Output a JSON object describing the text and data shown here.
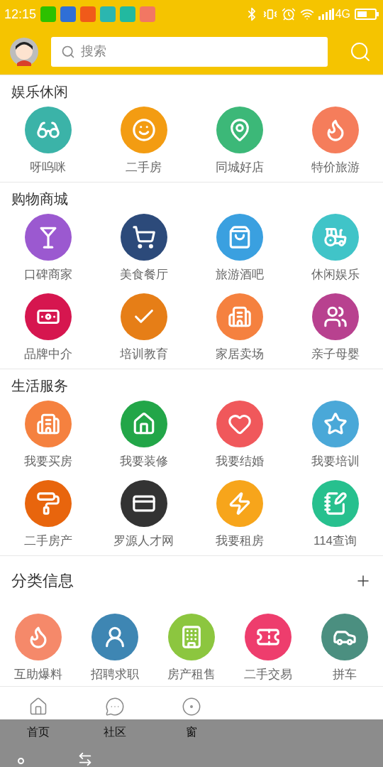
{
  "status_bar": {
    "time": "12:15",
    "network": "4G"
  },
  "search": {
    "placeholder": "搜索"
  },
  "sections": [
    {
      "title": "娱乐休闲",
      "items": [
        {
          "label": "呀呜咪",
          "color": "#3bb3a8"
        },
        {
          "label": "二手房",
          "color": "#f39c12"
        },
        {
          "label": "同城好店",
          "color": "#3cb878"
        },
        {
          "label": "特价旅游",
          "color": "#f57d5b"
        }
      ]
    },
    {
      "title": "购物商城",
      "items": [
        {
          "label": "口碑商家",
          "color": "#9b59d0"
        },
        {
          "label": "美食餐厅",
          "color": "#2c4a7a"
        },
        {
          "label": "旅游酒吧",
          "color": "#3aa0e0"
        },
        {
          "label": "休闲娱乐",
          "color": "#40c4c8"
        },
        {
          "label": "品牌中介",
          "color": "#d6164f"
        },
        {
          "label": "培训教育",
          "color": "#e67e17"
        },
        {
          "label": "家居卖场",
          "color": "#f5813f"
        },
        {
          "label": "亲子母婴",
          "color": "#b8418f"
        }
      ]
    },
    {
      "title": "生活服务",
      "items": [
        {
          "label": "我要买房",
          "color": "#f5813f"
        },
        {
          "label": "我要装修",
          "color": "#22a648"
        },
        {
          "label": "我要结婚",
          "color": "#f0585b"
        },
        {
          "label": "我要培训",
          "color": "#4aa8d8"
        },
        {
          "label": "二手房产",
          "color": "#e8650d"
        },
        {
          "label": "罗源人才网",
          "color": "#333333"
        },
        {
          "label": "我要租房",
          "color": "#f7a51b"
        },
        {
          "label": "114查询",
          "color": "#27c08e"
        }
      ]
    }
  ],
  "classified": {
    "title": "分类信息",
    "items": [
      {
        "label": "互助爆料",
        "color": "#f5896a"
      },
      {
        "label": "招聘求职",
        "color": "#3e86b3"
      },
      {
        "label": "房产租售",
        "color": "#8cc63f"
      },
      {
        "label": "二手交易",
        "color": "#ee3d6d"
      },
      {
        "label": "拼车",
        "color": "#4b8f80"
      }
    ]
  },
  "tabs": [
    {
      "label": "首页"
    },
    {
      "label": "社区"
    },
    {
      "label": "窗"
    }
  ]
}
